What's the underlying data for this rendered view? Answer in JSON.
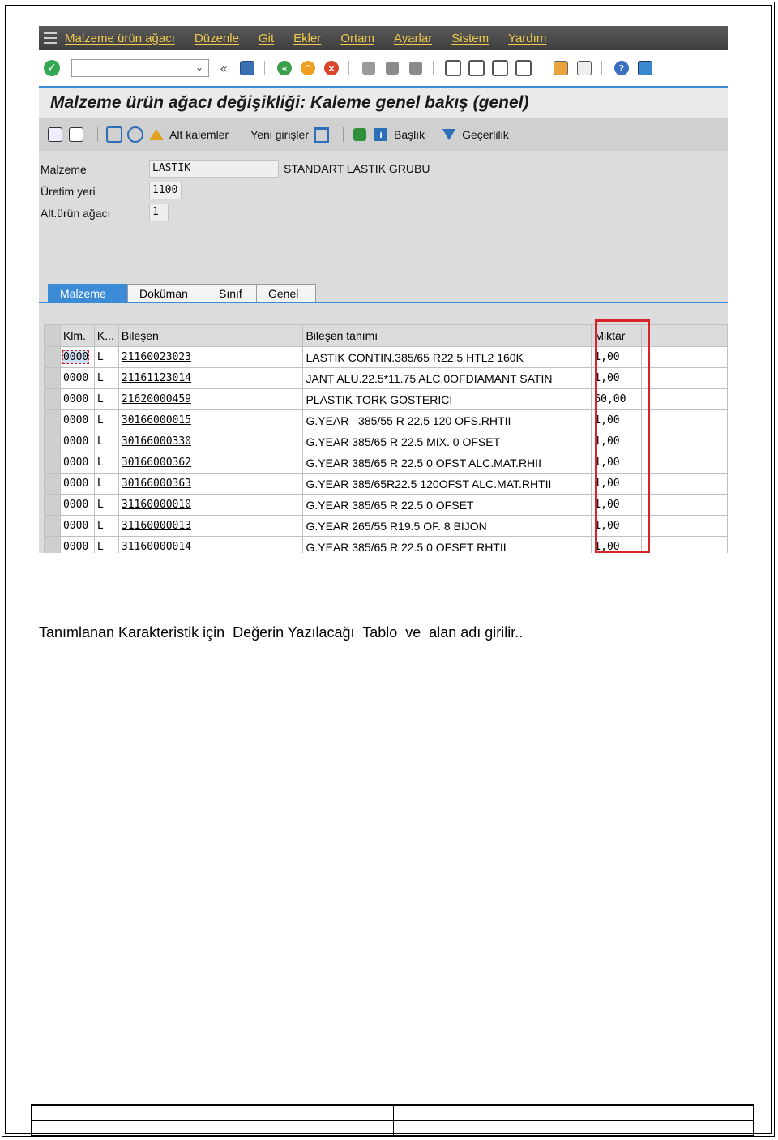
{
  "menubar": {
    "items": [
      "Malzeme ürün ağacı",
      "Düzenle",
      "Git",
      "Ekler",
      "Ortam",
      "Ayarlar",
      "Sistem",
      "Yardım"
    ]
  },
  "title": "Malzeme ürün ağacı değişikliği: Kaleme genel bakış (genel)",
  "app_toolbar": {
    "alt_kalemler": "Alt kalemler",
    "yeni_girisler": "Yeni girişler",
    "baslik": "Başlık",
    "gecerlilik": "Geçerlilik"
  },
  "header": {
    "malzeme_label": "Malzeme",
    "malzeme_value": "LASTIK",
    "malzeme_desc": "STANDART LASTIK GRUBU",
    "uretim_label": "Üretim yeri",
    "uretim_value": "1100",
    "alt_label": "Alt.ürün ağacı",
    "alt_value": "1"
  },
  "tabs": [
    "Malzeme",
    "Doküman",
    "Sınıf",
    "Genel"
  ],
  "table": {
    "headers": [
      "Klm.",
      "K...",
      "Bileşen",
      "Bileşen tanımı",
      "Miktar"
    ],
    "rows": [
      [
        "0000",
        "L",
        "21160023023",
        "LASTIK CONTIN.385/65 R22.5 HTL2 160K",
        "1,00"
      ],
      [
        "0000",
        "L",
        "21161123014",
        "JANT ALU.22.5*11.75 ALC.0OFDIAMANT SATIN",
        "1,00"
      ],
      [
        "0000",
        "L",
        "21620000459",
        "PLASTIK TORK GOSTERICI",
        "60,00"
      ],
      [
        "0000",
        "L",
        "30166000015",
        "G.YEAR   385/55 R 22.5 120 OFS.RHTII",
        "1,00"
      ],
      [
        "0000",
        "L",
        "30166000330",
        "G.YEAR 385/65 R 22.5 MIX. 0 OFSET",
        "1,00"
      ],
      [
        "0000",
        "L",
        "30166000362",
        "G.YEAR 385/65 R 22.5 0 OFST ALC.MAT.RHII",
        "1,00"
      ],
      [
        "0000",
        "L",
        "30166000363",
        "G.YEAR 385/65R22.5 120OFST ALC.MAT.RHTII",
        "1,00"
      ],
      [
        "0000",
        "L",
        "31160000010",
        "G.YEAR 385/65 R 22.5 0 OFSET",
        "1,00"
      ],
      [
        "0000",
        "L",
        "31160000013",
        "G.YEAR 265/55 R19.5 OF. 8 BİJON",
        "1,00"
      ],
      [
        "0000",
        "L",
        "31160000014",
        "G.YEAR 385/65 R 22.5 0 OFSET RHTII",
        "1,00"
      ]
    ]
  },
  "caption": "Tanımlanan Karakteristik için  Değerin Yazılacağı  Tablo  ve  alan adı girilir..",
  "colors": {
    "menubar_bg": "#4a4a4a",
    "menu_text": "#f2c94c",
    "accent_blue": "#3b8bd6",
    "highlight_red": "#d8232a",
    "ok_green": "#33a852"
  }
}
